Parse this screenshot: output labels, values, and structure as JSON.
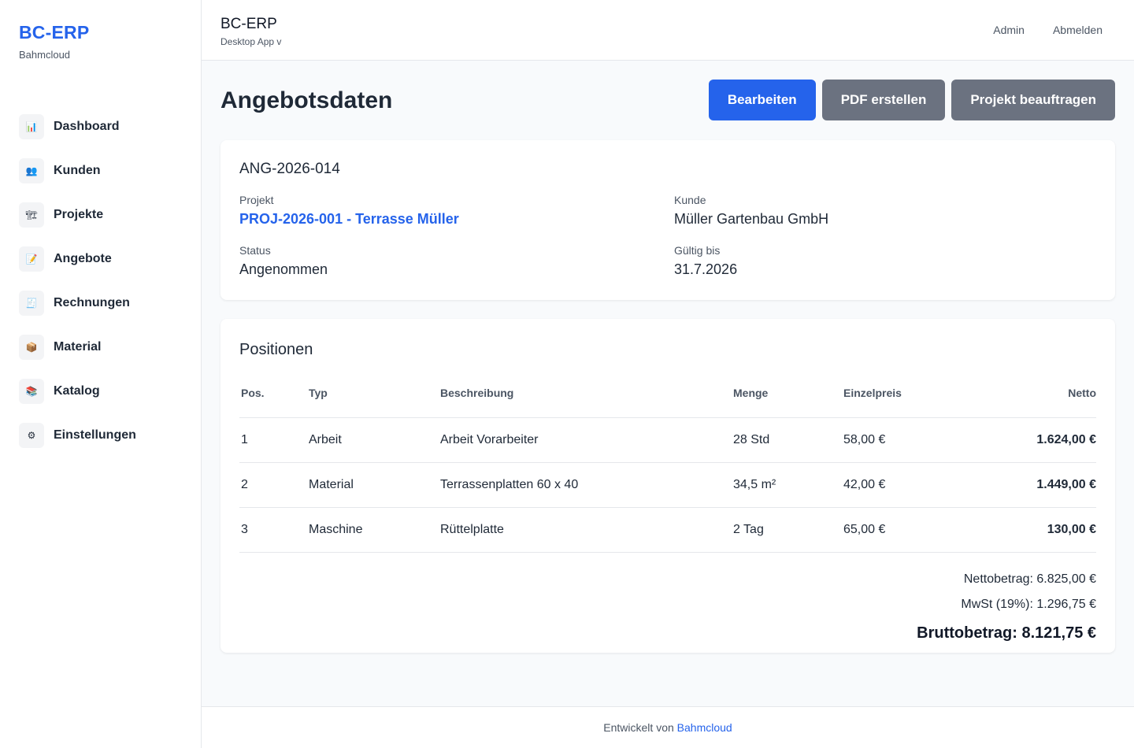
{
  "sidebar": {
    "brand": "BC-ERP",
    "company": "Bahmcloud",
    "items": [
      {
        "label": "Dashboard",
        "icon": "📊"
      },
      {
        "label": "Kunden",
        "icon": "👥"
      },
      {
        "label": "Projekte",
        "icon": "🏗"
      },
      {
        "label": "Angebote",
        "icon": "📝"
      },
      {
        "label": "Rechnungen",
        "icon": "🧾"
      },
      {
        "label": "Material",
        "icon": "📦"
      },
      {
        "label": "Katalog",
        "icon": "📚"
      },
      {
        "label": "Einstellungen",
        "icon": "⚙"
      }
    ]
  },
  "header": {
    "title": "BC-ERP",
    "subtitle": "Desktop App v",
    "admin": "Admin",
    "logout": "Abmelden"
  },
  "page": {
    "title": "Angebotsdaten",
    "buttons": {
      "edit": "Bearbeiten",
      "pdf": "PDF erstellen",
      "order": "Projekt beauftragen"
    }
  },
  "offer": {
    "number": "ANG-2026-014",
    "project_label": "Projekt",
    "project_value": "PROJ-2026-001 - Terrasse Müller",
    "customer_label": "Kunde",
    "customer_value": "Müller Gartenbau GmbH",
    "status_label": "Status",
    "status_value": "Angenommen",
    "valid_label": "Gültig bis",
    "valid_value": "31.7.2026"
  },
  "positions": {
    "title": "Positionen",
    "columns": [
      "Pos.",
      "Typ",
      "Beschreibung",
      "Menge",
      "Einzelpreis",
      "Netto"
    ],
    "rows": [
      {
        "pos": "1",
        "typ": "Arbeit",
        "desc": "Arbeit Vorarbeiter",
        "menge": "28 Std",
        "ep": "58,00 €",
        "netto": "1.624,00 €"
      },
      {
        "pos": "2",
        "typ": "Material",
        "desc": "Terrassenplatten 60 x 40",
        "menge": "34,5 m²",
        "ep": "42,00 €",
        "netto": "1.449,00 €"
      },
      {
        "pos": "3",
        "typ": "Maschine",
        "desc": "Rüttelplatte",
        "menge": "2 Tag",
        "ep": "65,00 €",
        "netto": "130,00 €"
      }
    ],
    "totals": {
      "net": "Nettobetrag: 6.825,00 €",
      "vat": "MwSt (19%): 1.296,75 €",
      "gross": "Bruttobetrag: 8.121,75 €"
    }
  },
  "footer": {
    "text": "Entwickelt von",
    "link": "Bahmcloud"
  }
}
